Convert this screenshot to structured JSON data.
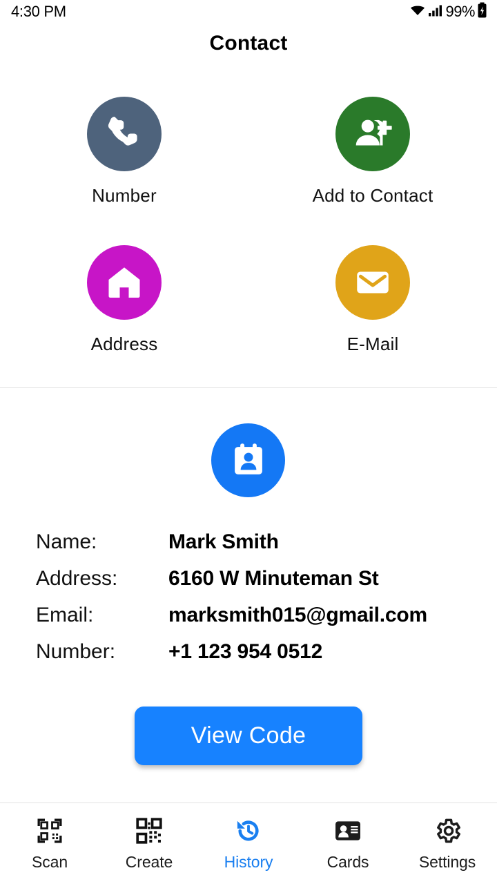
{
  "status_bar": {
    "time": "4:30 PM",
    "battery_percent": "99%",
    "icons": [
      "wifi-icon",
      "cellular-signal-icon",
      "battery-charging-icon"
    ]
  },
  "header": {
    "title": "Contact"
  },
  "actions": [
    {
      "label": "Number",
      "icon": "phone-icon",
      "color": "#4e637c"
    },
    {
      "label": "Add to Contact",
      "icon": "person-add-icon",
      "color": "#2a7a2a"
    },
    {
      "label": "Address",
      "icon": "home-icon",
      "color": "#c715c7"
    },
    {
      "label": "E-Mail",
      "icon": "envelope-icon",
      "color": "#e0a419"
    }
  ],
  "contact": {
    "avatar_icon": "contact-book-icon",
    "avatar_color": "#1478f5",
    "fields": [
      {
        "label": "Name:",
        "value": "Mark Smith"
      },
      {
        "label": "Address:",
        "value": "6160 W Minuteman St"
      },
      {
        "label": "Email:",
        "value": "marksmith015@gmail.com"
      },
      {
        "label": "Number:",
        "value": "+1 123 954 0512"
      }
    ]
  },
  "primary_button": {
    "label": "View Code",
    "color": "#1782ff"
  },
  "bottom_nav": {
    "active_color": "#1a7ff0",
    "items": [
      {
        "label": "Scan",
        "icon": "qr-scan-icon",
        "active": false
      },
      {
        "label": "Create",
        "icon": "qr-create-icon",
        "active": false
      },
      {
        "label": "History",
        "icon": "history-icon",
        "active": true
      },
      {
        "label": "Cards",
        "icon": "id-card-icon",
        "active": false
      },
      {
        "label": "Settings",
        "icon": "gear-icon",
        "active": false
      }
    ]
  }
}
